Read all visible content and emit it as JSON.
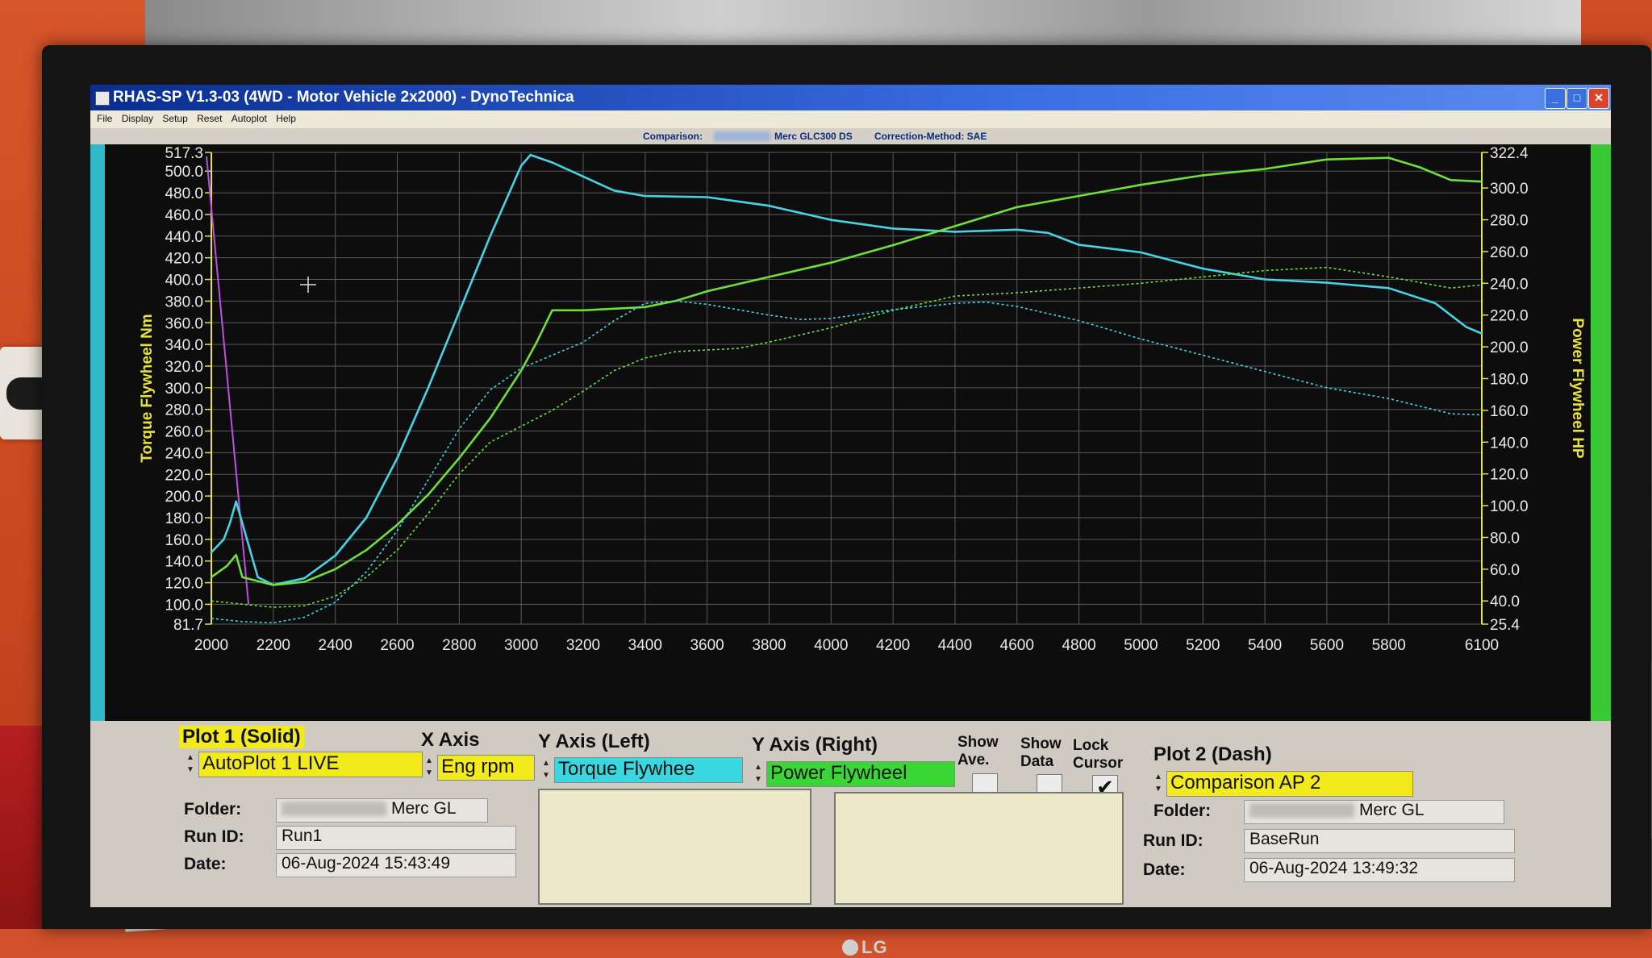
{
  "window": {
    "title": "RHAS-SP V1.3-03  (4WD - Motor Vehicle 2x2000) - DynoTechnica",
    "buttons": {
      "minimize": "_",
      "maximize": "□",
      "close": "✕"
    }
  },
  "menu": [
    "File",
    "Display",
    "Setup",
    "Reset",
    "Autoplot",
    "Help"
  ],
  "comparison_bar": {
    "label": "Comparison:",
    "vehicle": "Merc GLC300 DS",
    "correction": "Correction-Method: SAE"
  },
  "colors": {
    "torque_live": "#46d3e6",
    "power_live": "#6fe03a",
    "plot_bg": "#0d0d0d",
    "left_axis": "#e8e23a",
    "right_axis": "#e8e23a",
    "cursor_line": "#c04fe0"
  },
  "chart_data": {
    "type": "line",
    "x_axis": {
      "label": "",
      "range": [
        2000,
        6100
      ],
      "ticks": [
        "2000",
        "2200",
        "2400",
        "2600",
        "2800",
        "3000",
        "3200",
        "3400",
        "3600",
        "3800",
        "4000",
        "4200",
        "4400",
        "4600",
        "4800",
        "5000",
        "5200",
        "5400",
        "5600",
        "5800",
        "6100"
      ]
    },
    "y_left": {
      "label": "Torque Flywheel Nm",
      "range": [
        81.7,
        517.3
      ],
      "ticks": [
        "517.3",
        "500.0",
        "480.0",
        "460.0",
        "440.0",
        "420.0",
        "400.0",
        "380.0",
        "360.0",
        "340.0",
        "320.0",
        "300.0",
        "280.0",
        "260.0",
        "240.0",
        "220.0",
        "200.0",
        "180.0",
        "160.0",
        "140.0",
        "120.0",
        "100.0",
        "81.7"
      ]
    },
    "y_right": {
      "label": "Power Flywheel HP",
      "range": [
        25.4,
        322.4
      ],
      "ticks": [
        "322.4",
        "300.0",
        "280.0",
        "260.0",
        "240.0",
        "220.0",
        "200.0",
        "180.0",
        "160.0",
        "140.0",
        "120.0",
        "100.0",
        "80.0",
        "60.0",
        "40.0",
        "25.4"
      ]
    },
    "grid": true,
    "series": [
      {
        "name": "Torque Flywheel",
        "axis": "left",
        "style": "solid",
        "x": [
          2000,
          2040,
          2060,
          2080,
          2150,
          2200,
          2300,
          2400,
          2500,
          2600,
          2700,
          2800,
          2900,
          3000,
          3030,
          3100,
          3200,
          3300,
          3400,
          3600,
          3800,
          4000,
          4200,
          4400,
          4600,
          4700,
          4800,
          5000,
          5200,
          5400,
          5600,
          5800,
          5950,
          6050,
          6100
        ],
        "y": [
          148,
          160,
          175,
          195,
          125,
          118,
          124,
          145,
          180,
          235,
          300,
          370,
          440,
          505,
          515,
          508,
          495,
          482,
          477,
          476,
          468,
          455,
          447,
          444,
          446,
          443,
          432,
          425,
          410,
          400,
          397,
          392,
          378,
          356,
          350
        ]
      },
      {
        "name": "Power Flywheel",
        "axis": "right",
        "style": "solid",
        "x": [
          2000,
          2050,
          2080,
          2100,
          2200,
          2300,
          2400,
          2500,
          2600,
          2700,
          2800,
          2900,
          3000,
          3050,
          3100,
          3200,
          3300,
          3400,
          3500,
          3600,
          3800,
          4000,
          4200,
          4400,
          4600,
          4800,
          5000,
          5200,
          5400,
          5600,
          5800,
          5900,
          6000,
          6100
        ],
        "y": [
          55,
          62,
          69,
          55,
          50,
          52,
          60,
          72,
          88,
          107,
          130,
          155,
          185,
          203,
          223,
          223,
          224,
          225,
          229,
          235,
          244,
          253,
          264,
          276,
          288,
          295,
          302,
          308,
          312,
          318,
          319,
          313,
          305,
          304
        ]
      },
      {
        "name": "Comparison Torque",
        "axis": "left",
        "style": "dash",
        "x": [
          2000,
          2100,
          2200,
          2300,
          2400,
          2500,
          2600,
          2700,
          2800,
          2900,
          3000,
          3100,
          3200,
          3300,
          3400,
          3500,
          3600,
          3700,
          3800,
          3900,
          4000,
          4200,
          4400,
          4500,
          4600,
          4800,
          5000,
          5200,
          5400,
          5600,
          5800,
          6000,
          6100
        ],
        "y": [
          87,
          84,
          83,
          88,
          102,
          130,
          168,
          215,
          262,
          298,
          318,
          330,
          342,
          362,
          378,
          380,
          377,
          372,
          367,
          363,
          364,
          372,
          378,
          379,
          375,
          362,
          345,
          330,
          315,
          300,
          290,
          276,
          275
        ]
      },
      {
        "name": "Comparison Power",
        "axis": "right",
        "style": "dash",
        "x": [
          2000,
          2100,
          2200,
          2300,
          2400,
          2500,
          2600,
          2700,
          2800,
          2900,
          3000,
          3100,
          3200,
          3300,
          3400,
          3500,
          3600,
          3700,
          3800,
          4000,
          4200,
          4400,
          4600,
          4800,
          5000,
          5200,
          5400,
          5600,
          5800,
          6000,
          6100
        ],
        "y": [
          40,
          38,
          36,
          37,
          43,
          55,
          72,
          95,
          120,
          140,
          150,
          160,
          172,
          185,
          193,
          197,
          198,
          199,
          203,
          212,
          223,
          232,
          234,
          237,
          240,
          244,
          248,
          250,
          244,
          237,
          239
        ]
      }
    ]
  },
  "panel": {
    "plot1": {
      "header": "Plot 1 (Solid)",
      "select": "AutoPlot 1 LIVE",
      "folder_label": "Folder:",
      "folder_value": "Merc GL",
      "runid_label": "Run ID:",
      "runid_value": "Run1",
      "date_label": "Date:",
      "date_value": "06-Aug-2024  15:43:49"
    },
    "x_axis": {
      "header": "X Axis",
      "select": "Eng rpm"
    },
    "y_left": {
      "header": "Y Axis (Left)",
      "select": "Torque Flywhee"
    },
    "y_right": {
      "header": "Y Axis (Right)",
      "select": "Power Flywheel"
    },
    "toggles": {
      "show_ave": {
        "label_1": "Show",
        "label_2": "Ave.",
        "checked": false
      },
      "show_data": {
        "label_1": "Show",
        "label_2": "Data",
        "checked": false
      },
      "lock_cursor": {
        "label_1": "Lock",
        "label_2": "Cursor",
        "checked": true,
        "mark": "✔"
      }
    },
    "plot2": {
      "header": "Plot 2 (Dash)",
      "select": "Comparison AP 2",
      "folder_label": "Folder:",
      "folder_value": "Merc GL",
      "runid_label": "Run ID:",
      "runid_value": "BaseRun",
      "date_label": "Date:",
      "date_value": "06-Aug-2024  13:49:32"
    }
  },
  "monitor": {
    "brand": "LG"
  }
}
